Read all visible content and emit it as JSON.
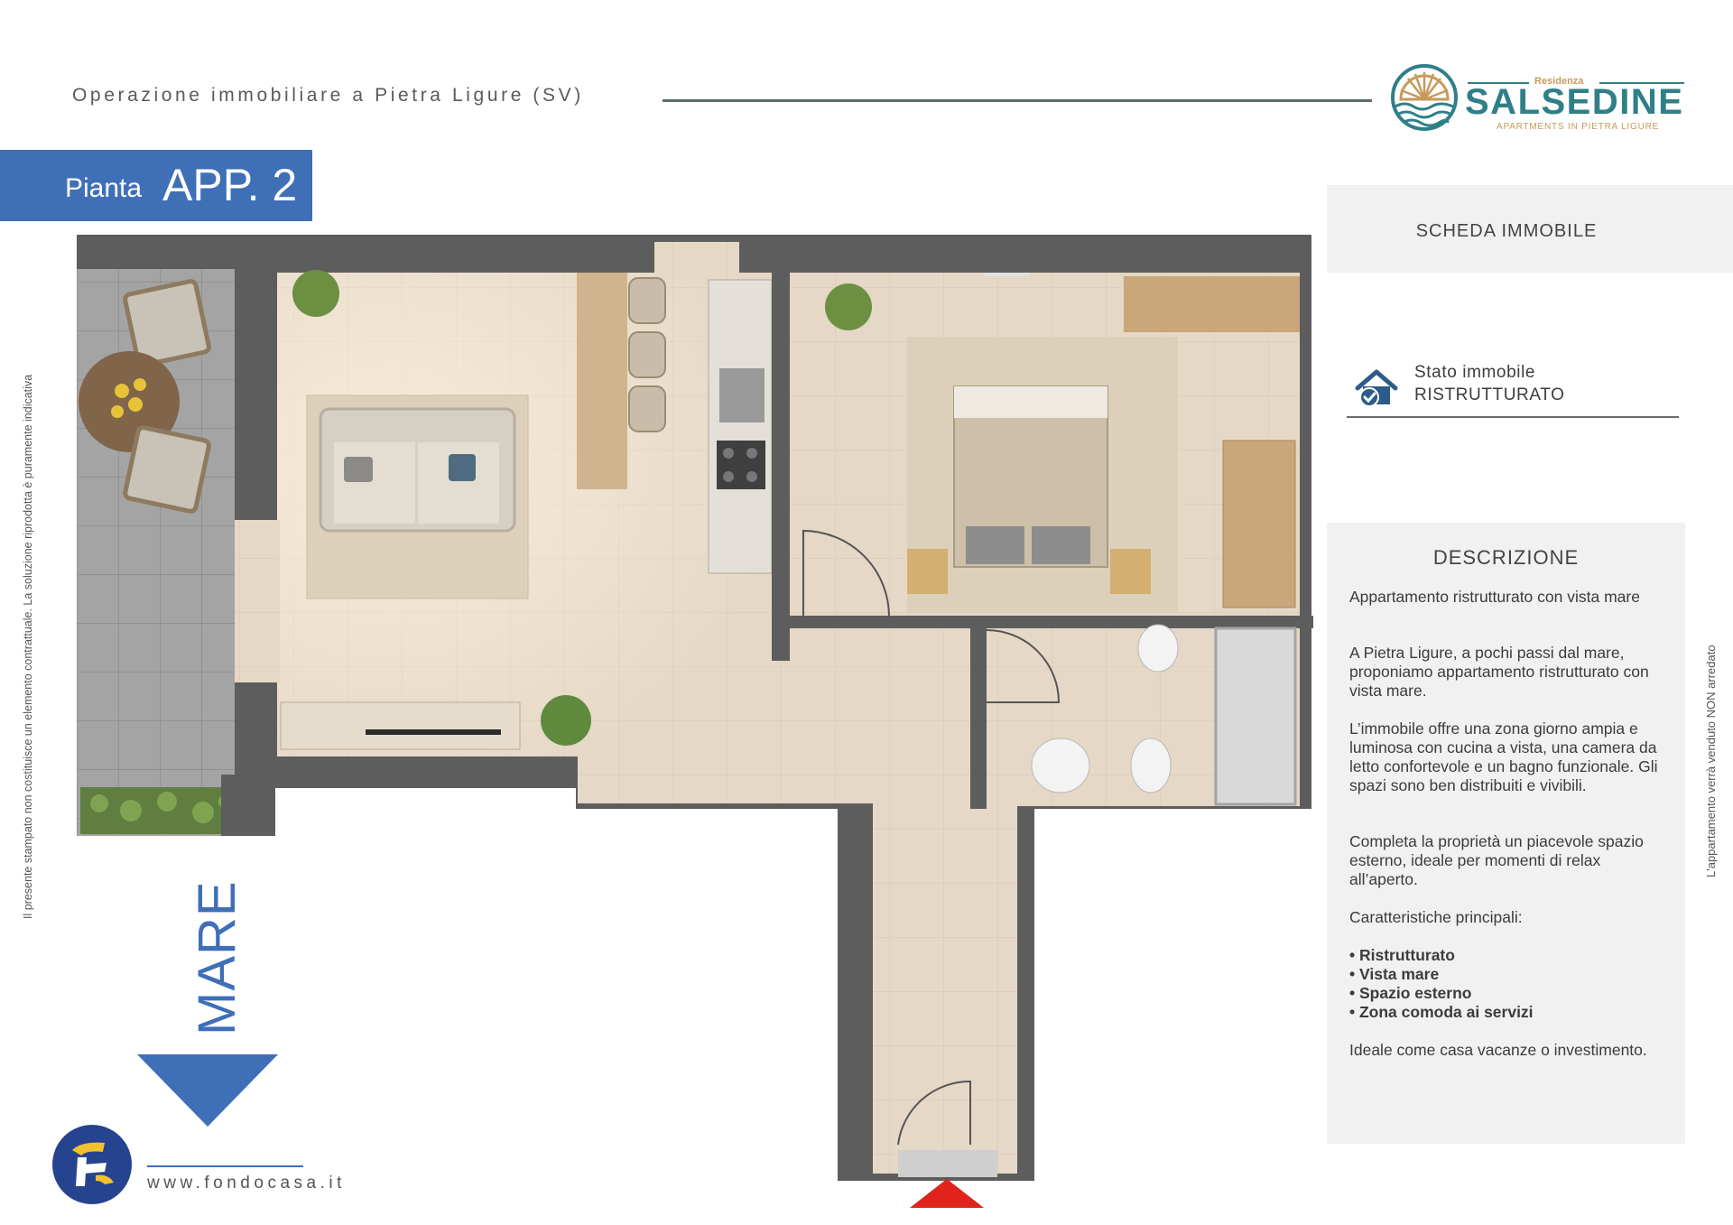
{
  "header": {
    "subtitle": "Operazione immobiliare a Pietra Ligure (SV)",
    "logo": {
      "small": "Residenza",
      "brand": "SALSEDINE",
      "tagline": "APARTMENTS IN PIETRA LIGURE",
      "colors": {
        "teal": "#2f7f88",
        "gold": "#c79a5a"
      }
    }
  },
  "title": {
    "prefix": "Pianta",
    "unit": "APP. 2",
    "band_color": "#3f6fb6"
  },
  "side_notes": {
    "left": "Il presente stampato non costituisce un elemento contrattuale. La soluzione riprodotta è puramente indicativa",
    "right": "L'appartamento verrà venduto NON arredato"
  },
  "sea_direction": {
    "label": "MARE",
    "arrow_icon": "arrow-down-triangle-icon",
    "color": "#3f6fb6"
  },
  "entrance_marker_icon": "entrance-triangle-icon",
  "footer": {
    "website": "www.fondocasa.it",
    "logo_icon": "fondocasa-logo-icon"
  },
  "scheda": {
    "title": "SCHEDA IMMOBILE",
    "stato_label": "Stato immobile",
    "stato_value": "RISTRUTTURATO",
    "stato_icon": "house-check-icon"
  },
  "descrizione": {
    "title": "DESCRIZIONE",
    "p1": "Appartamento ristrutturato con vista mare",
    "p2": "A Pietra Ligure, a pochi passi dal mare, proponiamo appartamento ristrutturato con vista mare.",
    "p3": "L’immobile offre una zona giorno ampia e luminosa con cucina a vista, una camera da letto confortevole e un bagno funzionale. Gli spazi sono ben distribuiti e vivibili.",
    "p4": "Completa la proprietà un piacevole spazio esterno, ideale per momenti di relax all’aperto.",
    "features_heading": "Caratteristiche principali:",
    "features": [
      "• Ristrutturato",
      "• Vista mare",
      "• Spazio esterno",
      "• Zona comoda ai servizi"
    ],
    "closing": "Ideale come casa vacanze o investimento."
  }
}
